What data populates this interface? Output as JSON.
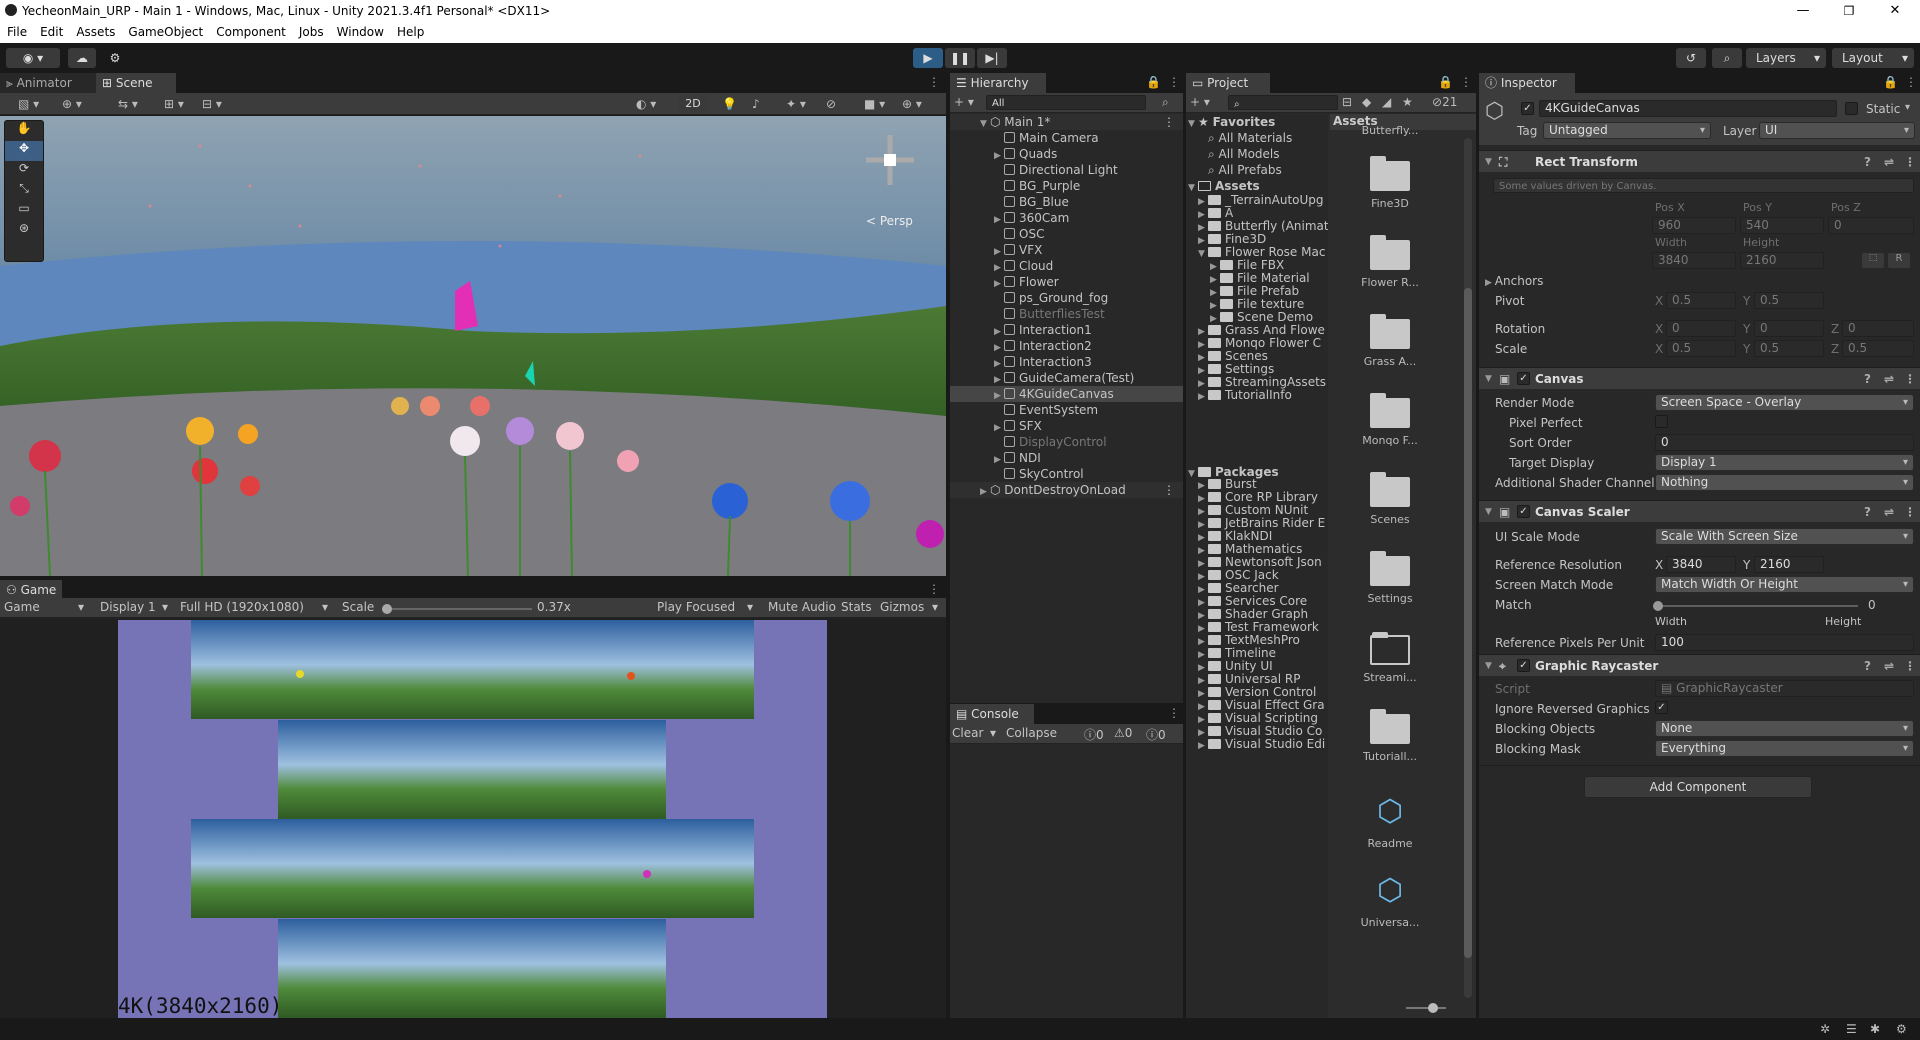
{
  "window": {
    "title": "YecheonMain_URP - Main 1 - Windows, Mac, Linux - Unity 2021.3.4f1 Personal* <DX11>",
    "min": "—",
    "max": "❐",
    "close": "✕"
  },
  "menu": [
    "File",
    "Edit",
    "Assets",
    "GameObject",
    "Component",
    "Jobs",
    "Window",
    "Help"
  ],
  "toolbar": {
    "layers": "Layers",
    "layout": "Layout"
  },
  "scene": {
    "tab_animator": "Animator",
    "tab_scene": "Scene",
    "mode2d": "2D",
    "persp": "< Persp"
  },
  "game": {
    "tab": "Game",
    "view": "Game",
    "display": "Display 1",
    "resolution": "Full HD (1920x1080)",
    "scale_label": "Scale",
    "scale_value": "0.37x",
    "play_focused": "Play Focused",
    "mute": "Mute Audio",
    "stats": "Stats",
    "gizmos": "Gizmos",
    "overlay_text": "4K(3840x2160)"
  },
  "hierarchy": {
    "tab": "Hierarchy",
    "search_placeholder": "All",
    "scene": "Main 1*",
    "items": [
      {
        "label": "Main Camera",
        "arrow": false,
        "dim": false
      },
      {
        "label": "Quads",
        "arrow": true,
        "dim": false
      },
      {
        "label": "Directional Light",
        "arrow": false,
        "dim": false
      },
      {
        "label": "BG_Purple",
        "arrow": false,
        "dim": false
      },
      {
        "label": "BG_Blue",
        "arrow": false,
        "dim": false
      },
      {
        "label": "360Cam",
        "arrow": true,
        "dim": false
      },
      {
        "label": "OSC",
        "arrow": false,
        "dim": false
      },
      {
        "label": "VFX",
        "arrow": true,
        "dim": false
      },
      {
        "label": "Cloud",
        "arrow": true,
        "dim": false
      },
      {
        "label": "Flower",
        "arrow": true,
        "dim": false
      },
      {
        "label": "ps_Ground_fog",
        "arrow": false,
        "dim": false
      },
      {
        "label": "ButterfliesTest",
        "arrow": false,
        "dim": true
      },
      {
        "label": "Interaction1",
        "arrow": true,
        "dim": false
      },
      {
        "label": "Interaction2",
        "arrow": true,
        "dim": false
      },
      {
        "label": "Interaction3",
        "arrow": true,
        "dim": false
      },
      {
        "label": "GuideCamera(Test)",
        "arrow": true,
        "dim": false
      },
      {
        "label": "4KGuideCanvas",
        "arrow": true,
        "dim": false,
        "sel": true
      },
      {
        "label": "EventSystem",
        "arrow": false,
        "dim": false
      },
      {
        "label": "SFX",
        "arrow": true,
        "dim": false
      },
      {
        "label": "DisplayControl",
        "arrow": false,
        "dim": true
      },
      {
        "label": "NDI",
        "arrow": true,
        "dim": false
      },
      {
        "label": "SkyControl",
        "arrow": false,
        "dim": false
      }
    ],
    "dontdestroy": "DontDestroyOnLoad"
  },
  "console": {
    "tab": "Console",
    "clear": "Clear",
    "collapse": "Collapse",
    "count_log": "0",
    "count_warn": "0",
    "count_err": "0"
  },
  "project": {
    "tab": "Project",
    "count": "21",
    "favorites": "Favorites",
    "fav_items": [
      "All Materials",
      "All Models",
      "All Prefabs"
    ],
    "assets_label": "Assets",
    "asset_tree": [
      {
        "label": "_TerrainAutoUpg",
        "lvl": 1
      },
      {
        "label": "A",
        "lvl": 1
      },
      {
        "label": "Butterfly (Animat",
        "lvl": 1
      },
      {
        "label": "Fine3D",
        "lvl": 1
      },
      {
        "label": "Flower Rose Mac",
        "lvl": 1,
        "open": true
      },
      {
        "label": "File FBX",
        "lvl": 2
      },
      {
        "label": "File Material",
        "lvl": 2
      },
      {
        "label": "File Prefab",
        "lvl": 2
      },
      {
        "label": "File texture",
        "lvl": 2
      },
      {
        "label": "Scene Demo",
        "lvl": 2
      },
      {
        "label": "Grass And Flowe",
        "lvl": 1
      },
      {
        "label": "Monqo Flower C",
        "lvl": 1
      },
      {
        "label": "Scenes",
        "lvl": 1
      },
      {
        "label": "Settings",
        "lvl": 1
      },
      {
        "label": "StreamingAssets",
        "lvl": 1
      },
      {
        "label": "TutorialInfo",
        "lvl": 1
      }
    ],
    "packages": "Packages",
    "package_tree": [
      "Burst",
      "Core RP Library",
      "Custom NUnit",
      "JetBrains Rider E",
      "KlakNDI",
      "Mathematics",
      "Newtonsoft Json",
      "OSC Jack",
      "Searcher",
      "Services Core",
      "Shader Graph",
      "Test Framework",
      "TextMeshPro",
      "Timeline",
      "Unity UI",
      "Universal RP",
      "Version Control",
      "Visual Effect Gra",
      "Visual Scripting",
      "Visual Studio Co",
      "Visual Studio Edi"
    ],
    "grid_header": "Assets",
    "grid": [
      {
        "label": "Butterfly...",
        "type": "folder"
      },
      {
        "label": "Fine3D",
        "type": "folder"
      },
      {
        "label": "Flower R...",
        "type": "folder"
      },
      {
        "label": "Grass A...",
        "type": "folder"
      },
      {
        "label": "Monqo F...",
        "type": "folder"
      },
      {
        "label": "Scenes",
        "type": "folder"
      },
      {
        "label": "Settings",
        "type": "folder"
      },
      {
        "label": "Streami...",
        "type": "folder-open"
      },
      {
        "label": "Tutoriall...",
        "type": "folder"
      },
      {
        "label": "Readme",
        "type": "script"
      },
      {
        "label": "Universa...",
        "type": "script"
      }
    ]
  },
  "inspector": {
    "tab": "Inspector",
    "name": "4KGuideCanvas",
    "static": "Static",
    "tag_label": "Tag",
    "tag": "Untagged",
    "layer_label": "Layer",
    "layer": "UI",
    "rect": {
      "title": "Rect Transform",
      "note": "Some values driven by Canvas.",
      "posx_l": "Pos X",
      "posy_l": "Pos Y",
      "posz_l": "Pos Z",
      "posx": "960",
      "posy": "540",
      "posz": "0",
      "w_l": "Width",
      "h_l": "Height",
      "w": "3840",
      "h": "2160",
      "anchors": "Anchors",
      "pivot": "Pivot",
      "pivot_x": "0.5",
      "pivot_y": "0.5",
      "rotation": "Rotation",
      "rot_x": "0",
      "rot_y": "0",
      "rot_z": "0",
      "scale": "Scale",
      "sc_x": "0.5",
      "sc_y": "0.5",
      "sc_z": "0.5",
      "x": "X",
      "y": "Y",
      "z": "Z",
      "r": "R"
    },
    "canvas": {
      "title": "Canvas",
      "render_mode_l": "Render Mode",
      "render_mode": "Screen Space - Overlay",
      "pixel_perfect": "Pixel Perfect",
      "sort_order_l": "Sort Order",
      "sort_order": "0",
      "target_display_l": "Target Display",
      "target_display": "Display 1",
      "shader_ch_l": "Additional Shader Channels",
      "shader_ch": "Nothing"
    },
    "scaler": {
      "title": "Canvas Scaler",
      "ui_scale_l": "UI Scale Mode",
      "ui_scale": "Scale With Screen Size",
      "ref_res_l": "Reference Resolution",
      "ref_x": "3840",
      "ref_y": "2160",
      "match_mode_l": "Screen Match Mode",
      "match_mode": "Match Width Or Height",
      "match_l": "Match",
      "match_val": "0",
      "match_fraction": 0,
      "width_l": "Width",
      "height_l": "Height",
      "ref_ppu_l": "Reference Pixels Per Unit",
      "ref_ppu": "100"
    },
    "raycaster": {
      "title": "Graphic Raycaster",
      "script_l": "Script",
      "script": "GraphicRaycaster",
      "ignore_l": "Ignore Reversed Graphics",
      "blocking_obj_l": "Blocking Objects",
      "blocking_obj": "None",
      "blocking_mask_l": "Blocking Mask",
      "blocking_mask": "Everything"
    },
    "add_component": "Add Component"
  }
}
